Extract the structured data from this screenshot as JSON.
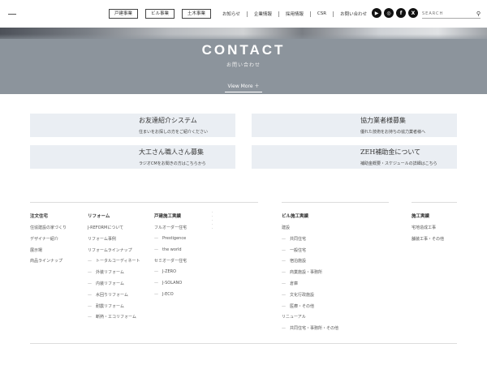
{
  "header": {
    "biz_tabs": [
      "戸建事業",
      "ビル事業",
      "土木事業"
    ],
    "nav": [
      "お知らせ",
      "企業情報",
      "採用情報",
      "CSR",
      "お問い合わせ"
    ],
    "social_icons": [
      "youtube-icon",
      "instagram-icon",
      "facebook-icon",
      "x-icon"
    ],
    "social_glyphs": [
      "▶",
      "◎",
      "f",
      "X"
    ],
    "search_placeholder": "SEARCH"
  },
  "banner": {
    "title": "CONTACT",
    "subtitle": "お問い合わせ",
    "view_more": "View More ＋"
  },
  "cards": [
    {
      "title": "お友達紹介システム",
      "desc": "住まいをお探しの方をご紹介ください"
    },
    {
      "title": "協力業者様募集",
      "desc": "優れた技術をお持ちの協力業者様へ"
    },
    {
      "title": "大工さん職人さん募集",
      "desc": "ラジオCMをお聞きの方はこちらから"
    },
    {
      "title": "ZEH補助金について",
      "desc": "補助金概要・スケジュールの詳細はこちら"
    }
  ],
  "footer": {
    "col1": {
      "title": "注文住宅",
      "items": [
        "住協建設の家づくり",
        "デザイナー紹介",
        "展示場",
        "商品ラインナップ"
      ]
    },
    "col2": {
      "title": "リフォーム",
      "items": [
        "J-REFORMについて",
        "リフォーム事例",
        "リフォームラインナップ",
        "トータルコーディネート",
        "外装リフォーム",
        "内装リフォーム",
        "水回りリフォーム",
        "耐震リフォーム",
        "断熱・エコリフォーム"
      ]
    },
    "col3": {
      "title": "戸建施工実績",
      "items": [
        "フルオーダー住宅",
        "Prestigence",
        "the world",
        "セミオーダー住宅",
        "J-ZERO",
        "J-SOLANO",
        "J-ECO"
      ]
    },
    "col4": {
      "title": "ビル施工実績",
      "items": [
        "建設",
        "共同住宅",
        "一般住宅",
        "宿泊施設",
        "商業施設・事務所",
        "倉庫",
        "文化行政施設",
        "医療・その他",
        "リニューアル",
        "共同住宅・事務所・その他"
      ]
    },
    "col5": {
      "title": "施工実績",
      "items": [
        "宅地造成工事",
        "舗装工事・その他"
      ]
    }
  }
}
